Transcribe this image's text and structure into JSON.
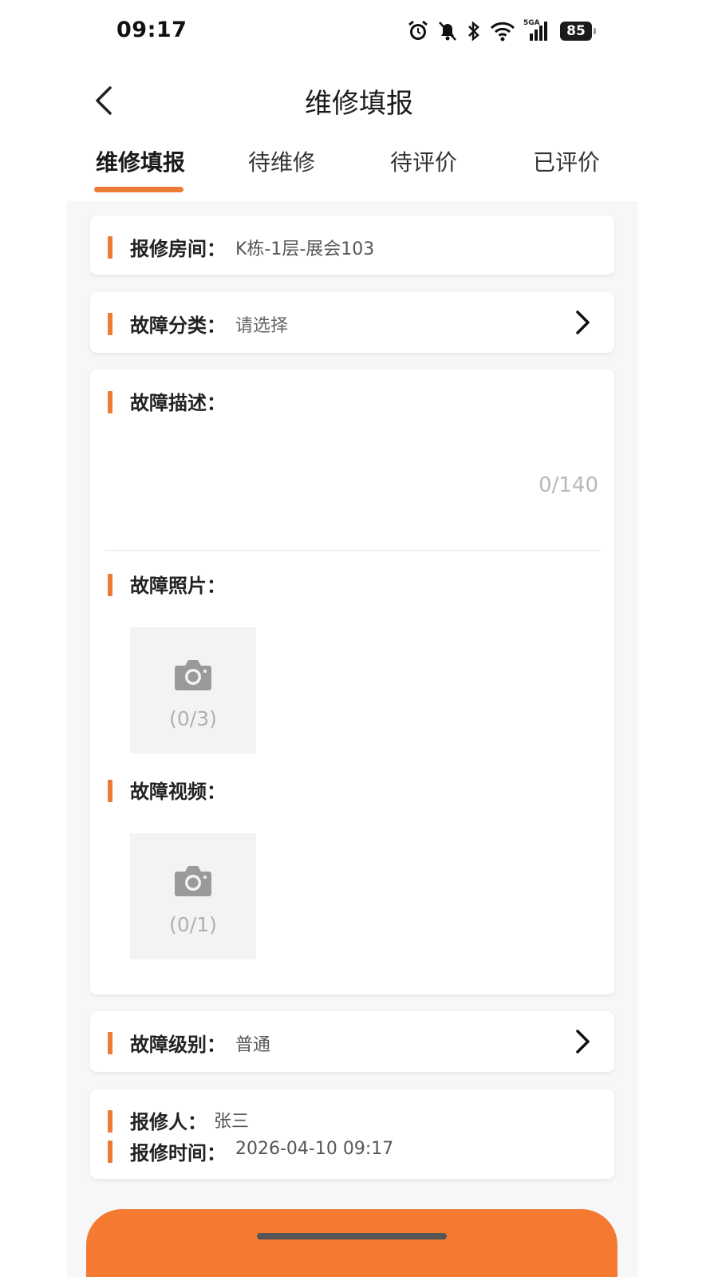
{
  "status_bar": {
    "time": "09:17",
    "icons": [
      "alarm-icon",
      "mute-icon",
      "bluetooth-icon",
      "wifi-icon",
      "signal-5g-icon"
    ],
    "network": "5GA",
    "battery": "85"
  },
  "header": {
    "title": "维修填报",
    "back_icon": "chevron-left-icon"
  },
  "tabs": [
    {
      "label": "维修填报",
      "active": true
    },
    {
      "label": "待维修",
      "active": false
    },
    {
      "label": "待评价",
      "active": false
    },
    {
      "label": "已评价",
      "active": false
    }
  ],
  "accent_color": "#ee7a35",
  "form": {
    "room": {
      "label": "报修房间：",
      "value": "K栋-1层-展会103"
    },
    "category": {
      "label": "故障分类：",
      "value": "请选择"
    },
    "description": {
      "label": "故障描述：",
      "value": "",
      "counter": "0/140"
    },
    "photos": {
      "label": "故障照片：",
      "count": "(0/3)"
    },
    "videos": {
      "label": "故障视频：",
      "count": "(0/1)"
    },
    "level": {
      "label": "故障级别：",
      "value": "普通"
    },
    "reporter": {
      "label": "报修人：",
      "value": "张三"
    },
    "report_time": {
      "label": "报修时间：",
      "value": "2026-04-10 09:17"
    }
  }
}
